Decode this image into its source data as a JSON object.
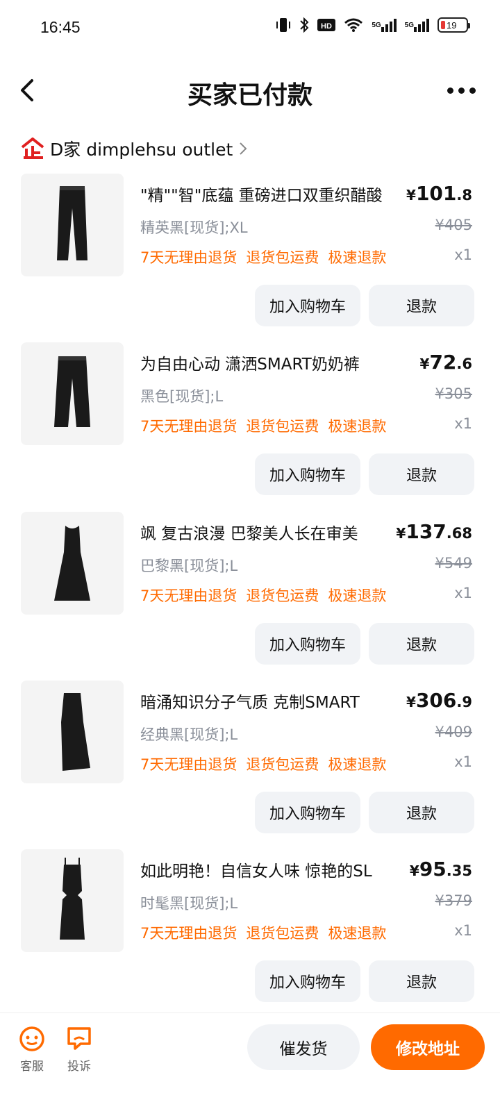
{
  "status_bar": {
    "time": "16:45",
    "net1": "5G",
    "net2": "5G",
    "hd_label": "HD",
    "battery": "19",
    "icons": [
      "vibrate-icon",
      "bluetooth-icon",
      "hd-icon",
      "wifi-icon",
      "signal-5g-icon",
      "signal-5g-icon",
      "battery-icon"
    ]
  },
  "header": {
    "title": "买家已付款",
    "back_icon": "chevron-left-icon",
    "more_icon": "more-dots-icon"
  },
  "shop": {
    "name": "D家 dimplehsu outlet",
    "icon": "shop-logo-icon",
    "brand_color": "#e02020"
  },
  "tags": [
    "7天无理由退货",
    "退货包运费",
    "极速退款"
  ],
  "buttons": {
    "add_cart": "加入购物车",
    "refund": "退款"
  },
  "items": [
    {
      "title": "\"精\"\"智\"底蕴 重磅进口双重织醋酸",
      "sku": "精英黑[现货];XL",
      "price_currency": "¥",
      "price_int": "101",
      "price_dec": ".8",
      "orig_price": "¥405",
      "qty": "x1",
      "thumb": "trousers-image"
    },
    {
      "title": "为自由心动 潇洒SMART奶奶裤",
      "sku": "黑色[现货];L",
      "price_currency": "¥",
      "price_int": "72",
      "price_dec": ".6",
      "orig_price": "¥305",
      "qty": "x1",
      "thumb": "wide-trousers-image"
    },
    {
      "title": "飒 复古浪漫 巴黎美人长在审美",
      "sku": "巴黎黑[现货];L",
      "price_currency": "¥",
      "price_int": "137",
      "price_dec": ".68",
      "orig_price": "¥549",
      "qty": "x1",
      "thumb": "sleeveless-dress-image"
    },
    {
      "title": "暗涌知识分子气质 克制SMART",
      "sku": "经典黑[现货];L",
      "price_currency": "¥",
      "price_int": "306",
      "price_dec": ".9",
      "orig_price": "¥409",
      "qty": "x1",
      "thumb": "asymmetric-dress-image"
    },
    {
      "title": "如此明艳！自信女人味 惊艳的SL",
      "sku": "时髦黑[现货];L",
      "price_currency": "¥",
      "price_int": "95",
      "price_dec": ".35",
      "orig_price": "¥379",
      "qty": "x1",
      "thumb": "cutout-dress-image"
    }
  ],
  "bottom_bar": {
    "service_label": "客服",
    "service_icon": "customer-service-icon",
    "complain_label": "投诉",
    "complain_icon": "complaint-icon",
    "urge_label": "催发货",
    "address_label": "修改地址",
    "accent_color": "#ff6a00"
  },
  "colors": {
    "tag_orange": "#ff6a00",
    "muted_gray": "#8a8f99",
    "button_bg": "#f1f3f6"
  }
}
